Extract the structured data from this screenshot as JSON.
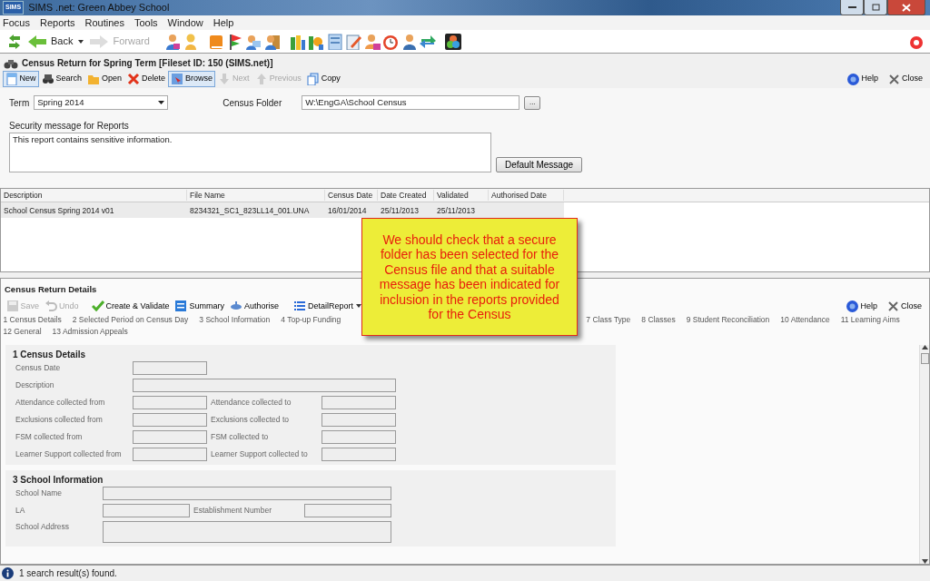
{
  "window": {
    "title": "SIMS .net: Green Abbey School",
    "logo": "SIMS"
  },
  "menu": [
    {
      "label": "Focus"
    },
    {
      "label": "Reports"
    },
    {
      "label": "Routines"
    },
    {
      "label": "Tools"
    },
    {
      "label": "Window"
    },
    {
      "label": "Help"
    }
  ],
  "nav": {
    "back": {
      "label": "Back",
      "disabled": false
    },
    "forward": {
      "label": "Forward",
      "disabled": true
    }
  },
  "record": {
    "title": "Census Return for Spring Term [Fileset ID:  150 (SIMS.net)]",
    "toolbar": [
      {
        "label": "New",
        "disabled": false,
        "selected": true,
        "kind": "doc"
      },
      {
        "label": "Search",
        "disabled": false,
        "selected": false,
        "kind": "binoculars"
      },
      {
        "label": "Open",
        "disabled": false,
        "selected": false,
        "kind": "folder"
      },
      {
        "label": "Delete",
        "disabled": false,
        "selected": false,
        "kind": "cross"
      },
      {
        "label": "Browse",
        "disabled": false,
        "selected": true,
        "kind": "browse"
      },
      {
        "label": "Next",
        "disabled": true,
        "selected": false,
        "kind": "down"
      },
      {
        "label": "Previous",
        "disabled": true,
        "selected": false,
        "kind": "up"
      },
      {
        "label": "Copy",
        "disabled": false,
        "selected": false,
        "kind": "copy"
      }
    ],
    "help": "Help",
    "close": "Close"
  },
  "form": {
    "term_label": "Term",
    "term_value": "Spring 2014",
    "folder_label": "Census Folder",
    "folder_value": "W:\\EngGA\\School Census",
    "browse_button": "...",
    "security_label": "Security message for Reports",
    "security_value": "This report contains sensitive information.",
    "default_button": "Default Message"
  },
  "table": {
    "columns": [
      "Description",
      "File Name",
      "Census Date",
      "Date Created",
      "Validated",
      "Authorised Date"
    ],
    "rows": [
      {
        "cells": [
          "School Census Spring 2014 v01",
          "8234321_SC1_823LL14_001.UNA",
          "16/01/2014",
          "25/11/2013",
          "25/11/2013",
          ""
        ],
        "selected": true
      }
    ]
  },
  "details": {
    "title": "Census Return Details",
    "toolbar": [
      {
        "label": "Save",
        "disabled": true,
        "kind": "save"
      },
      {
        "label": "Undo",
        "disabled": true,
        "kind": "undo"
      },
      {
        "label": "Create & Validate",
        "disabled": false,
        "kind": "tick"
      },
      {
        "label": "Summary",
        "disabled": false,
        "kind": "summary"
      },
      {
        "label": "Authorise",
        "disabled": false,
        "kind": "authorise"
      },
      {
        "label": "DetailReport",
        "disabled": false,
        "kind": "list"
      }
    ],
    "help": "Help",
    "close": "Close",
    "link_rows": [
      [
        "1 Census Details",
        "2 Selected Period on Census Day",
        "3 School Information",
        "4 Top-up Funding",
        "7 Class Type",
        "8 Classes",
        "9 Student Reconciliation",
        "10 Attendance",
        "11 Learning Aims"
      ],
      [
        "12 General",
        "13 Admission Appeals"
      ]
    ],
    "sections": [
      {
        "title": "1 Census Details",
        "fields": [
          {
            "label": "Census Date",
            "kind": "short"
          },
          {
            "label": "Description",
            "kind": "wide"
          },
          {
            "label": "Attendance collected from",
            "kind": "pair"
          },
          {
            "label": "Attendance collected to",
            "kind": "pair"
          },
          {
            "label": "Exclusions collected from",
            "kind": "pair"
          },
          {
            "label": "Exclusions collected to",
            "kind": "pair"
          },
          {
            "label": "FSM collected from",
            "kind": "pair"
          },
          {
            "label": "FSM collected to",
            "kind": "pair"
          },
          {
            "label": "Learner Support collected from",
            "kind": "pair"
          },
          {
            "label": "Learner Support collected to",
            "kind": "pair"
          }
        ]
      },
      {
        "title": "3 School Information",
        "fields": [
          {
            "label": "School Name",
            "kind": "wide"
          },
          {
            "label": "LA",
            "kind": "pair"
          },
          {
            "label": "Establishment Number",
            "kind": "pair"
          },
          {
            "label": "School Address",
            "kind": "area"
          }
        ]
      }
    ]
  },
  "callout": "We should check that a secure folder has been selected for the Census file and that a suitable message has been indicated for inclusion in the reports provided for the Census",
  "status_bar": "1 search result(s) found."
}
